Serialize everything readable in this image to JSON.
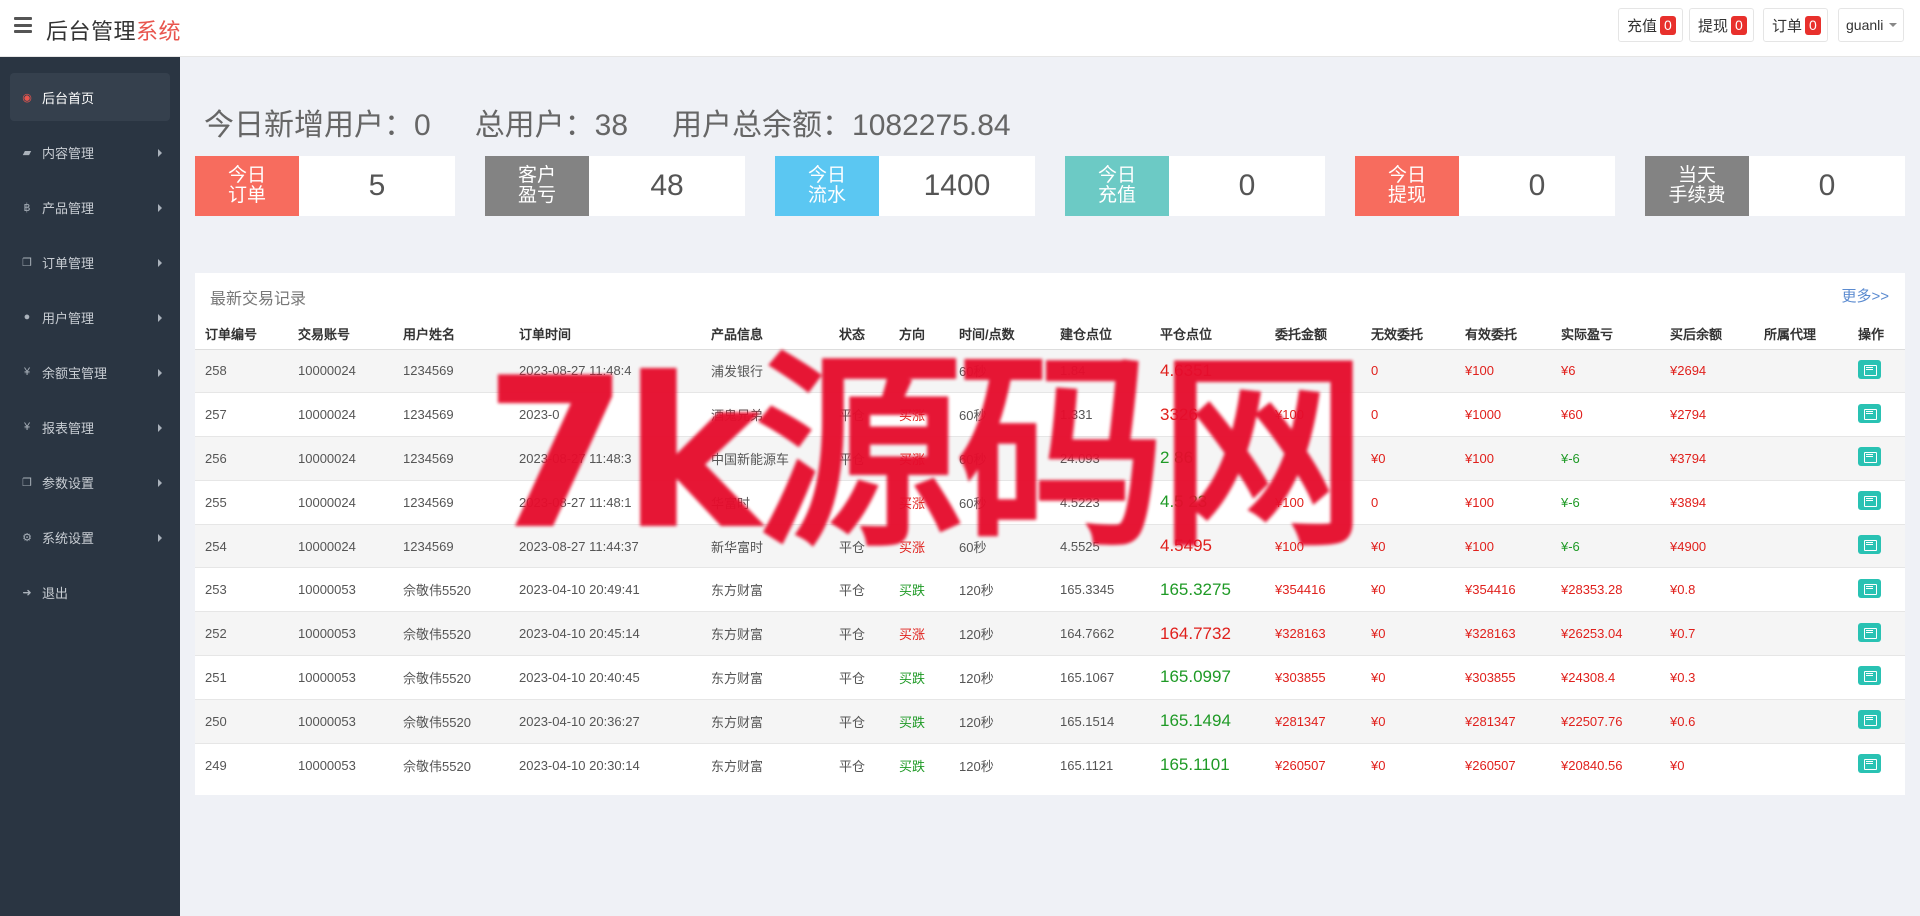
{
  "header": {
    "brand_main": "后台管理",
    "brand_accent": "系统",
    "buttons": [
      {
        "label": "充值",
        "count": "0"
      },
      {
        "label": "提现",
        "count": "0"
      },
      {
        "label": "订单",
        "count": "0"
      }
    ],
    "user": "guanli"
  },
  "sidebar": {
    "items": [
      {
        "label": "后台首页",
        "icon": "dashboard-icon"
      },
      {
        "label": "内容管理",
        "icon": "book-icon"
      },
      {
        "label": "产品管理",
        "icon": "bitcoin-icon"
      },
      {
        "label": "订单管理",
        "icon": "copy-icon"
      },
      {
        "label": "用户管理",
        "icon": "user-icon"
      },
      {
        "label": "余额宝管理",
        "icon": "yen-icon"
      },
      {
        "label": "报表管理",
        "icon": "yen-icon"
      },
      {
        "label": "参数设置",
        "icon": "copy-icon"
      },
      {
        "label": "系统设置",
        "icon": "gears-icon"
      },
      {
        "label": "退出",
        "icon": "sign-out-icon"
      }
    ]
  },
  "stats": {
    "new_users": "今日新增用户：0",
    "total_users": "总用户：38",
    "total_balance": "用户总余额：1082275.84"
  },
  "cards": [
    {
      "label": "今日\n订单",
      "value": "5",
      "color": "#f76c5e"
    },
    {
      "label": "客户\n盈亏",
      "value": "48",
      "color": "#838383"
    },
    {
      "label": "今日\n流水",
      "value": "1400",
      "color": "#5bc7f2"
    },
    {
      "label": "今日\n充值",
      "value": "0",
      "color": "#6ccac5"
    },
    {
      "label": "今日\n提现",
      "value": "0",
      "color": "#f76c5e"
    },
    {
      "label": "当天\n手续费",
      "value": "0",
      "color": "#838383"
    }
  ],
  "trades": {
    "title": "最新交易记录",
    "more": "更多>>",
    "columns": [
      "订单编号",
      "交易账号",
      "用户姓名",
      "订单时间",
      "产品信息",
      "状态",
      "方向",
      "时间/点数",
      "建仓点位",
      "平仓点位",
      "委托金额",
      "无效委托",
      "有效委托",
      "实际盈亏",
      "买后余额",
      "所属代理",
      "操作"
    ],
    "rows": [
      {
        "id": "258",
        "account": "10000024",
        "name": "1234569",
        "time": "2023-08-27 11:48:4",
        "product": "浦发银行",
        "status": "",
        "dir": "",
        "dir_color": "red",
        "period": "60秒",
        "open": "1.84",
        "close": "4.6351",
        "close_color": "red",
        "amount": "",
        "invalid": "0",
        "valid": "¥100",
        "pnl": "¥6",
        "pnl_color": "red",
        "balance": "¥2694",
        "agent": ""
      },
      {
        "id": "257",
        "account": "10000024",
        "name": "1234569",
        "time": "2023-0",
        "product": "酒鬼兄弟",
        "status": "平仓",
        "dir": "买涨",
        "dir_color": "red",
        "period": "60秒",
        "open": "1.331",
        "close": "3326",
        "close_color": "red",
        "amount": "¥100",
        "invalid": "0",
        "valid": "¥1000",
        "pnl": "¥60",
        "pnl_color": "red",
        "balance": "¥2794",
        "agent": ""
      },
      {
        "id": "256",
        "account": "10000024",
        "name": "1234569",
        "time": "2023-08-27 11:48:3",
        "product": "中国新能源车",
        "status": "平仓",
        "dir": "买涨",
        "dir_color": "red",
        "period": "60秒",
        "open": "24.093",
        "close": "2  86",
        "close_color": "green",
        "amount": "",
        "invalid": "¥0",
        "valid": "¥100",
        "pnl": "¥-6",
        "pnl_color": "green",
        "balance": "¥3794",
        "agent": ""
      },
      {
        "id": "255",
        "account": "10000024",
        "name": "1234569",
        "time": "2023-08-27 11:48:1",
        "product": "华富时",
        "status": "",
        "dir": "买涨",
        "dir_color": "red",
        "period": "60秒",
        "open": "4.5223",
        "close": "4.5 23",
        "close_color": "green",
        "amount": "¥100",
        "invalid": "0",
        "valid": "¥100",
        "pnl": "¥-6",
        "pnl_color": "green",
        "balance": "¥3894",
        "agent": ""
      },
      {
        "id": "254",
        "account": "10000024",
        "name": "1234569",
        "time": "2023-08-27 11:44:37",
        "product": "新华富时",
        "status": "平仓",
        "dir": "买涨",
        "dir_color": "red",
        "period": "60秒",
        "open": "4.5525",
        "close": "4.5495",
        "close_color": "red",
        "amount": "¥100",
        "invalid": "¥0",
        "valid": "¥100",
        "pnl": "¥-6",
        "pnl_color": "green",
        "balance": "¥4900",
        "agent": ""
      },
      {
        "id": "253",
        "account": "10000053",
        "name": "佘敬伟5520",
        "time": "2023-04-10 20:49:41",
        "product": "东方财富",
        "status": "平仓",
        "dir": "买跌",
        "dir_color": "green",
        "period": "120秒",
        "open": "165.3345",
        "close": "165.3275",
        "close_color": "green",
        "amount": "¥354416",
        "invalid": "¥0",
        "valid": "¥354416",
        "pnl": "¥28353.28",
        "pnl_color": "red",
        "balance": "¥0.8",
        "agent": ""
      },
      {
        "id": "252",
        "account": "10000053",
        "name": "佘敬伟5520",
        "time": "2023-04-10 20:45:14",
        "product": "东方财富",
        "status": "平仓",
        "dir": "买涨",
        "dir_color": "red",
        "period": "120秒",
        "open": "164.7662",
        "close": "164.7732",
        "close_color": "red",
        "amount": "¥328163",
        "invalid": "¥0",
        "valid": "¥328163",
        "pnl": "¥26253.04",
        "pnl_color": "red",
        "balance": "¥0.7",
        "agent": ""
      },
      {
        "id": "251",
        "account": "10000053",
        "name": "佘敬伟5520",
        "time": "2023-04-10 20:40:45",
        "product": "东方财富",
        "status": "平仓",
        "dir": "买跌",
        "dir_color": "green",
        "period": "120秒",
        "open": "165.1067",
        "close": "165.0997",
        "close_color": "green",
        "amount": "¥303855",
        "invalid": "¥0",
        "valid": "¥303855",
        "pnl": "¥24308.4",
        "pnl_color": "red",
        "balance": "¥0.3",
        "agent": ""
      },
      {
        "id": "250",
        "account": "10000053",
        "name": "佘敬伟5520",
        "time": "2023-04-10 20:36:27",
        "product": "东方财富",
        "status": "平仓",
        "dir": "买跌",
        "dir_color": "green",
        "period": "120秒",
        "open": "165.1514",
        "close": "165.1494",
        "close_color": "green",
        "amount": "¥281347",
        "invalid": "¥0",
        "valid": "¥281347",
        "pnl": "¥22507.76",
        "pnl_color": "red",
        "balance": "¥0.6",
        "agent": ""
      },
      {
        "id": "249",
        "account": "10000053",
        "name": "佘敬伟5520",
        "time": "2023-04-10 20:30:14",
        "product": "东方财富",
        "status": "平仓",
        "dir": "买跌",
        "dir_color": "green",
        "period": "120秒",
        "open": "165.1121",
        "close": "165.1101",
        "close_color": "green",
        "amount": "¥260507",
        "invalid": "¥0",
        "valid": "¥260507",
        "pnl": "¥20840.56",
        "pnl_color": "red",
        "balance": "¥0",
        "agent": ""
      }
    ]
  },
  "watermark": "7k源码网"
}
